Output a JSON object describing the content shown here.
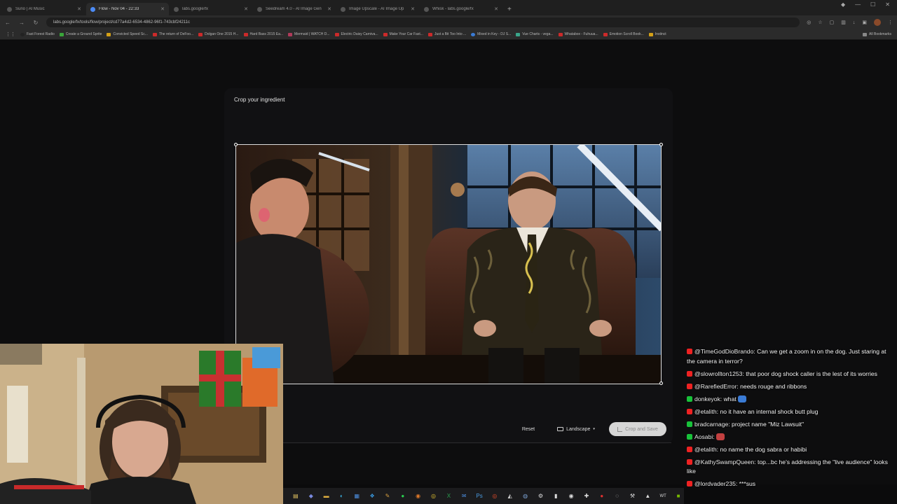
{
  "browser": {
    "tabs": [
      {
        "label": "Suno | AI Music",
        "active": false
      },
      {
        "label": "Flow - Nov 04 - 22:33",
        "active": true
      },
      {
        "label": "labs.google/fx",
        "active": false
      },
      {
        "label": "Seedream 4.0 - AI Image Gen",
        "active": false
      },
      {
        "label": "Image Upscale - AI Image Up",
        "active": false
      },
      {
        "label": "Whisk - labs.google/fx",
        "active": false
      }
    ],
    "new_tab": "+",
    "url": "labs.google/fx/tools/flow/project/cd77a4d2-6534-4862-96f1-743cbf24211c",
    "bookmarks": [
      {
        "label": "Fast Forest Radio",
        "color": "#cc2a2a"
      },
      {
        "label": "Create a Ground Sprite",
        "color": "#3aa53a"
      },
      {
        "label": "Convicted Speed Sc...",
        "color": "#d4a017"
      },
      {
        "label": "The return of DeFoo...",
        "color": "#cc2a2a"
      },
      {
        "label": "Dolgan One 2015 H...",
        "color": "#cc2a2a"
      },
      {
        "label": "Hard Bass 2015 Ea...",
        "color": "#cc2a2a"
      },
      {
        "label": "Mermaid | WATCH D...",
        "color": "#cc2a2a"
      },
      {
        "label": "Electric Daisy Carniva...",
        "color": "#cc2a2a"
      },
      {
        "label": "Make Your Car Fast...",
        "color": "#cc2a2a"
      },
      {
        "label": "Just a Bit Too Into ...",
        "color": "#cc2a2a"
      },
      {
        "label": "Mixed in Key - DJ S...",
        "color": "#3a7bd5"
      },
      {
        "label": "Vue Charts - vega...",
        "color": "#3aa58a"
      },
      {
        "label": "Whatabox - Fuhuua...",
        "color": "#cc2a2a"
      },
      {
        "label": "Emotion Scroll Book...",
        "color": "#cc2a2a"
      },
      {
        "label": "Instinct",
        "color": "#d4a017"
      }
    ],
    "all_bookmarks": "All Bookmarks"
  },
  "dialog": {
    "title": "Crop your ingredient",
    "reset_label": "Reset",
    "aspect_label": "Landscape",
    "crop_save_label": "Crop and Save"
  },
  "chat": [
    {
      "platform": "yt",
      "user": "@TimeGodDioBrando",
      "text": "Can we get a zoom in on the dog. Just staring at the camera in terror?"
    },
    {
      "platform": "yt",
      "user": "@slowrollton1253",
      "text": "that poor dog shock caller is the lest of its worries"
    },
    {
      "platform": "yt",
      "user": "@RarefiedError",
      "text": "needs rouge and ribbons"
    },
    {
      "platform": "tw",
      "user": "donkeyok",
      "text": "what",
      "emote": "#3a7bd5"
    },
    {
      "platform": "yt",
      "user": "@etalith",
      "text": "no it have an internal shock butt plug"
    },
    {
      "platform": "tw",
      "user": "bradcarnage",
      "text": "project name \"Miz Lawsuit\""
    },
    {
      "platform": "tw",
      "user": "Aosabi",
      "text": "",
      "emote": "#c24040"
    },
    {
      "platform": "yt",
      "user": "@etalith",
      "text": "no name the dog sabra or habibi"
    },
    {
      "platform": "yt",
      "user": "@KathySwampQueen",
      "text": "top...bc he's addressing the \"live audience\" looks like"
    },
    {
      "platform": "yt",
      "user": "@lordvader235",
      "text": "***sus"
    }
  ]
}
